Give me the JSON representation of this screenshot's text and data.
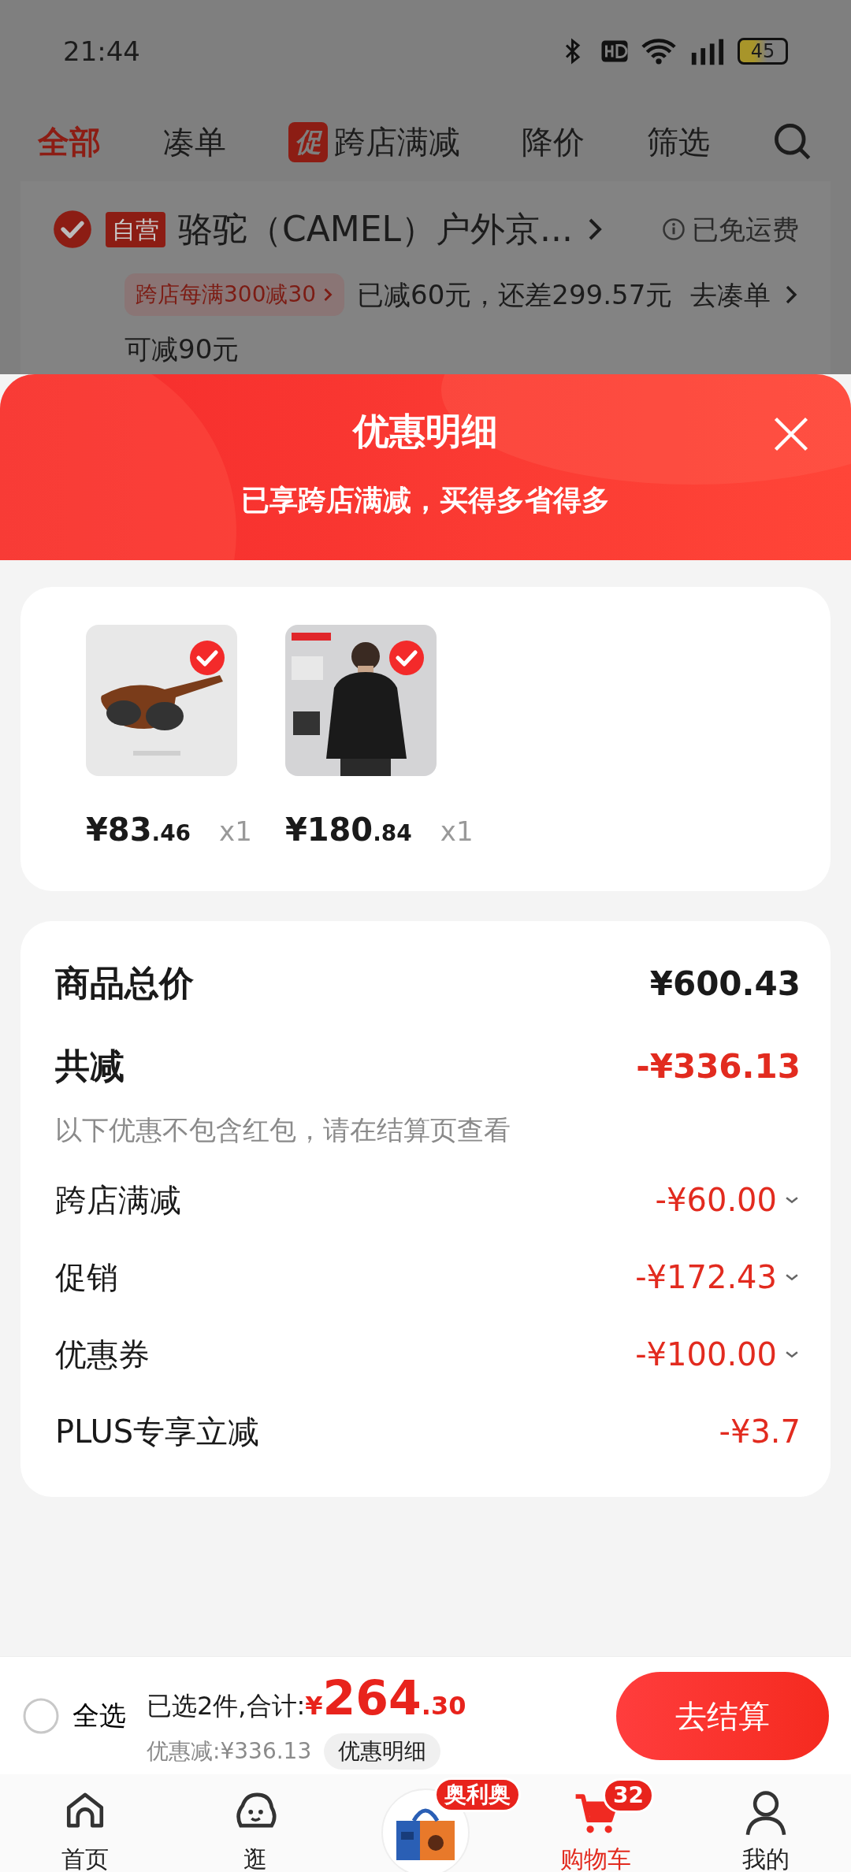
{
  "status_bar": {
    "time": "21:44",
    "battery": "45"
  },
  "filter_tabs": [
    {
      "label": "全部",
      "selected": true
    },
    {
      "label": "凑单",
      "selected": false
    },
    {
      "label": "跨店满减",
      "badge": "促",
      "selected": false
    },
    {
      "label": "降价",
      "selected": false
    },
    {
      "label": "筛选",
      "selected": false
    }
  ],
  "store": {
    "checked": true,
    "tag": "自营",
    "name": "骆驼（CAMEL）户外京...",
    "shipping": "已免运费"
  },
  "promo": {
    "tag": "跨店每满300减30",
    "progress": "已减60元，还差299.57元",
    "link": "去凑单",
    "note": "可减90元"
  },
  "sheet": {
    "title": "优惠明细",
    "subtitle": "已享跨店满减，买得多省得多",
    "items": [
      {
        "kind": "glasses",
        "selected": true,
        "price_int": "¥83",
        "price_dec": ".46",
        "qty": "x1"
      },
      {
        "kind": "coat",
        "selected": true,
        "price_int": "¥180",
        "price_dec": ".84",
        "qty": "x1"
      }
    ],
    "summary": {
      "total_label": "商品总价",
      "total": "¥600.43",
      "discount_label": "共减",
      "discount": "-¥336.13",
      "note": "以下优惠不包含红包，请在结算页查看",
      "rows": [
        {
          "label": "跨店满减",
          "amount": "-¥60.00",
          "expandable": true
        },
        {
          "label": "促销",
          "amount": "-¥172.43",
          "expandable": true
        },
        {
          "label": "优惠券",
          "amount": "-¥100.00",
          "expandable": true
        },
        {
          "label": "PLUS专享立减",
          "amount": "-¥3.7",
          "expandable": false
        }
      ]
    }
  },
  "checkout": {
    "select_all": {
      "label": "全选",
      "checked": false
    },
    "selected_text": "已选2件,合计:",
    "currency": "¥",
    "amount_int": "264",
    "amount_dec": ".30",
    "saved": "优惠减:¥336.13",
    "detail_button": "优惠明细",
    "button": "去结算"
  },
  "bottom_nav": [
    {
      "kind": "home",
      "label": "首页",
      "selected": false
    },
    {
      "kind": "mascot",
      "label": "逛",
      "selected": false
    },
    {
      "kind": "promo",
      "badge": "奥利奥",
      "selected": false
    },
    {
      "kind": "cart",
      "label": "购物车",
      "badge": "32",
      "selected": true
    },
    {
      "kind": "person",
      "label": "我的",
      "selected": false
    }
  ]
}
